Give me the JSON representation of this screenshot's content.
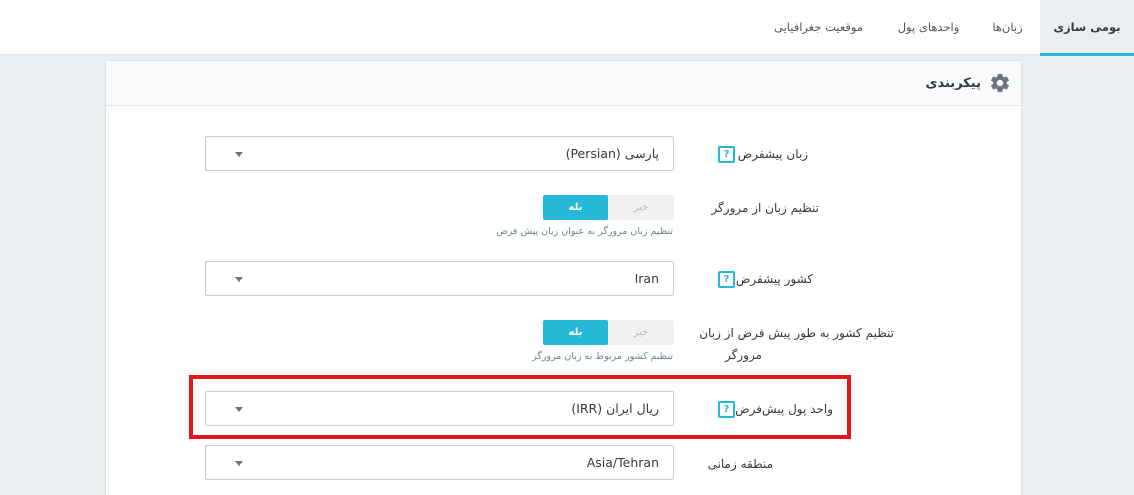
{
  "tabs": [
    {
      "label": "بومی سازی",
      "active": true
    },
    {
      "label": "زبان‌ها",
      "active": false
    },
    {
      "label": "واحدهای پول",
      "active": false
    },
    {
      "label": "موقعیت جغرافیایی",
      "active": false
    }
  ],
  "panel": {
    "title": "پیکربندی",
    "icon": "gear-icon"
  },
  "form": {
    "default_language": {
      "label": "زبان پیشفرض",
      "value": "(Persian) پارسی",
      "help": "?"
    },
    "browser_language": {
      "label": "تنظیم زبان از مرورگر",
      "yes": "بله",
      "no": "خیر",
      "selected": "yes",
      "hint": "تنظیم زبان مرورگر به عنوان زبان پیش فرض"
    },
    "default_country": {
      "label": "کشور پیشفرض",
      "value": "Iran",
      "help": "?"
    },
    "browser_country": {
      "label_line1": "تنظیم کشور به طور پیش فرض از زبان",
      "label_line2": "مرورگر",
      "yes": "بله",
      "no": "خیر",
      "selected": "yes",
      "hint": "تنظیم کشور مربوط به زبان مرورگر"
    },
    "default_currency": {
      "label": "واحد پول پیش‌فرض",
      "value": "(IRR) ریال ایران",
      "help": "?"
    },
    "timezone": {
      "label": "منطقه زمانی",
      "value": "Asia/Tehran"
    }
  },
  "colors": {
    "accent": "#25b9d7",
    "highlight_box": "#e3161c"
  }
}
